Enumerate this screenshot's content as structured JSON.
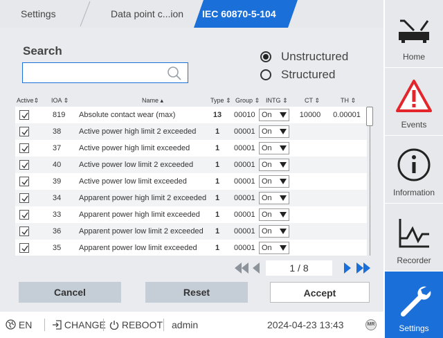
{
  "breadcrumb": {
    "items": [
      "Settings",
      "Data point c...ion",
      "IEC 60870-5-104"
    ]
  },
  "search": {
    "label": "Search",
    "value": "",
    "placeholder": ""
  },
  "view_mode": {
    "options": [
      "Unstructured",
      "Structured"
    ],
    "selected": "Unstructured"
  },
  "table": {
    "headers": {
      "active": "Active",
      "ioa": "IOA",
      "name": "Name",
      "type": "Type",
      "group": "Group",
      "intg": "INTG",
      "ct": "CT",
      "th": "TH"
    },
    "rows": [
      {
        "ioa": "819",
        "name": "Absolute contact wear (max)",
        "type": "13",
        "group": "00010",
        "intg": "On",
        "ct": "10000",
        "th": "0.00001"
      },
      {
        "ioa": "38",
        "name": "Active power high limit 2 exceeded",
        "type": "1",
        "group": "00001",
        "intg": "On",
        "ct": "",
        "th": ""
      },
      {
        "ioa": "37",
        "name": "Active power high limit exceeded",
        "type": "1",
        "group": "00001",
        "intg": "On",
        "ct": "",
        "th": ""
      },
      {
        "ioa": "40",
        "name": "Active power low limit 2 exceeded",
        "type": "1",
        "group": "00001",
        "intg": "On",
        "ct": "",
        "th": ""
      },
      {
        "ioa": "39",
        "name": "Active power low limit exceeded",
        "type": "1",
        "group": "00001",
        "intg": "On",
        "ct": "",
        "th": ""
      },
      {
        "ioa": "34",
        "name": "Apparent power high limit 2 exceeded",
        "type": "1",
        "group": "00001",
        "intg": "On",
        "ct": "",
        "th": ""
      },
      {
        "ioa": "33",
        "name": "Apparent power high limit exceeded",
        "type": "1",
        "group": "00001",
        "intg": "On",
        "ct": "",
        "th": ""
      },
      {
        "ioa": "36",
        "name": "Apparent power low limit 2 exceeded",
        "type": "1",
        "group": "00001",
        "intg": "On",
        "ct": "",
        "th": ""
      },
      {
        "ioa": "35",
        "name": "Apparent power low limit exceeded",
        "type": "1",
        "group": "00001",
        "intg": "On",
        "ct": "",
        "th": ""
      }
    ]
  },
  "pager": {
    "text": "1 / 8"
  },
  "actions": {
    "cancel": "Cancel",
    "reset": "Reset",
    "accept": "Accept"
  },
  "statusbar": {
    "language": "EN",
    "change": "CHANGE",
    "reboot": "REBOOT",
    "user": "admin",
    "datetime": "2024-04-23 13:43",
    "badge": "MR"
  },
  "sidebar": {
    "items": [
      {
        "label": "Home",
        "icon": "home-icon"
      },
      {
        "label": "Events",
        "icon": "warning-icon"
      },
      {
        "label": "Information",
        "icon": "info-icon"
      },
      {
        "label": "Recorder",
        "icon": "recorder-icon"
      },
      {
        "label": "Settings",
        "icon": "wrench-icon"
      }
    ],
    "active": "Settings"
  },
  "colors": {
    "accent": "#1a6fd8",
    "alert": "#e3262b",
    "panel": "#e9ebee"
  }
}
